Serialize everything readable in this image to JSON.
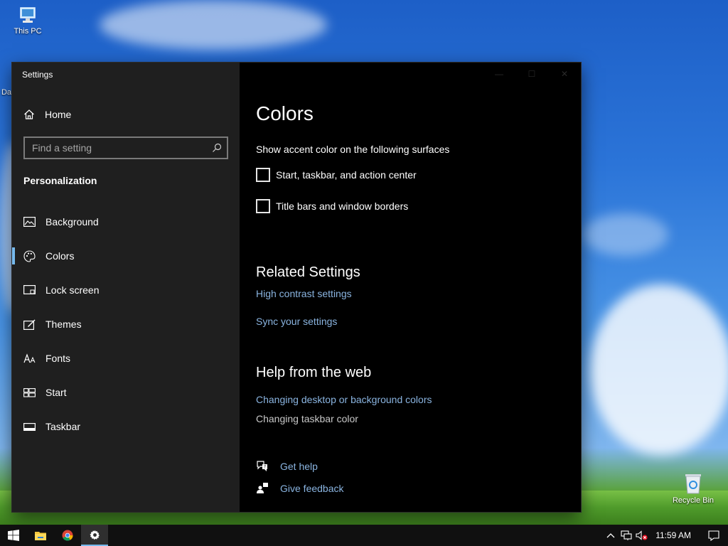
{
  "desktop": {
    "this_pc_label": "This PC",
    "recycle_bin_label": "Recycle Bin",
    "partial_label": "Da"
  },
  "window": {
    "title": "Settings",
    "caption": {
      "minimize": "—",
      "maximize": "☐",
      "close": "✕"
    }
  },
  "sidebar": {
    "home_label": "Home",
    "search_placeholder": "Find a setting",
    "section_title": "Personalization",
    "items": [
      {
        "label": "Background",
        "icon": "image-icon"
      },
      {
        "label": "Colors",
        "icon": "palette-icon",
        "active": true
      },
      {
        "label": "Lock screen",
        "icon": "lock-screen-icon"
      },
      {
        "label": "Themes",
        "icon": "themes-brush-icon"
      },
      {
        "label": "Fonts",
        "icon": "fonts-icon"
      },
      {
        "label": "Start",
        "icon": "start-tiles-icon"
      },
      {
        "label": "Taskbar",
        "icon": "taskbar-icon"
      }
    ]
  },
  "main": {
    "title": "Colors",
    "surfaces_label": "Show accent color on the following surfaces",
    "checkboxes": [
      {
        "label": "Start, taskbar, and action center",
        "checked": false
      },
      {
        "label": "Title bars and window borders",
        "checked": false
      }
    ],
    "related_heading": "Related Settings",
    "related_links": [
      "High contrast settings",
      "Sync your settings"
    ],
    "help_heading": "Help from the web",
    "help_link": "Changing desktop or background colors",
    "help_text": "Changing taskbar color",
    "get_help": "Get help",
    "give_feedback": "Give feedback"
  },
  "taskbar": {
    "time": "11:59 AM",
    "accent": "#76b9ed"
  },
  "colors": {
    "sidebar_bg": "#1f1f1f",
    "content_bg": "#000000",
    "link": "#8ab4e0",
    "accent": "#76b9ed"
  }
}
